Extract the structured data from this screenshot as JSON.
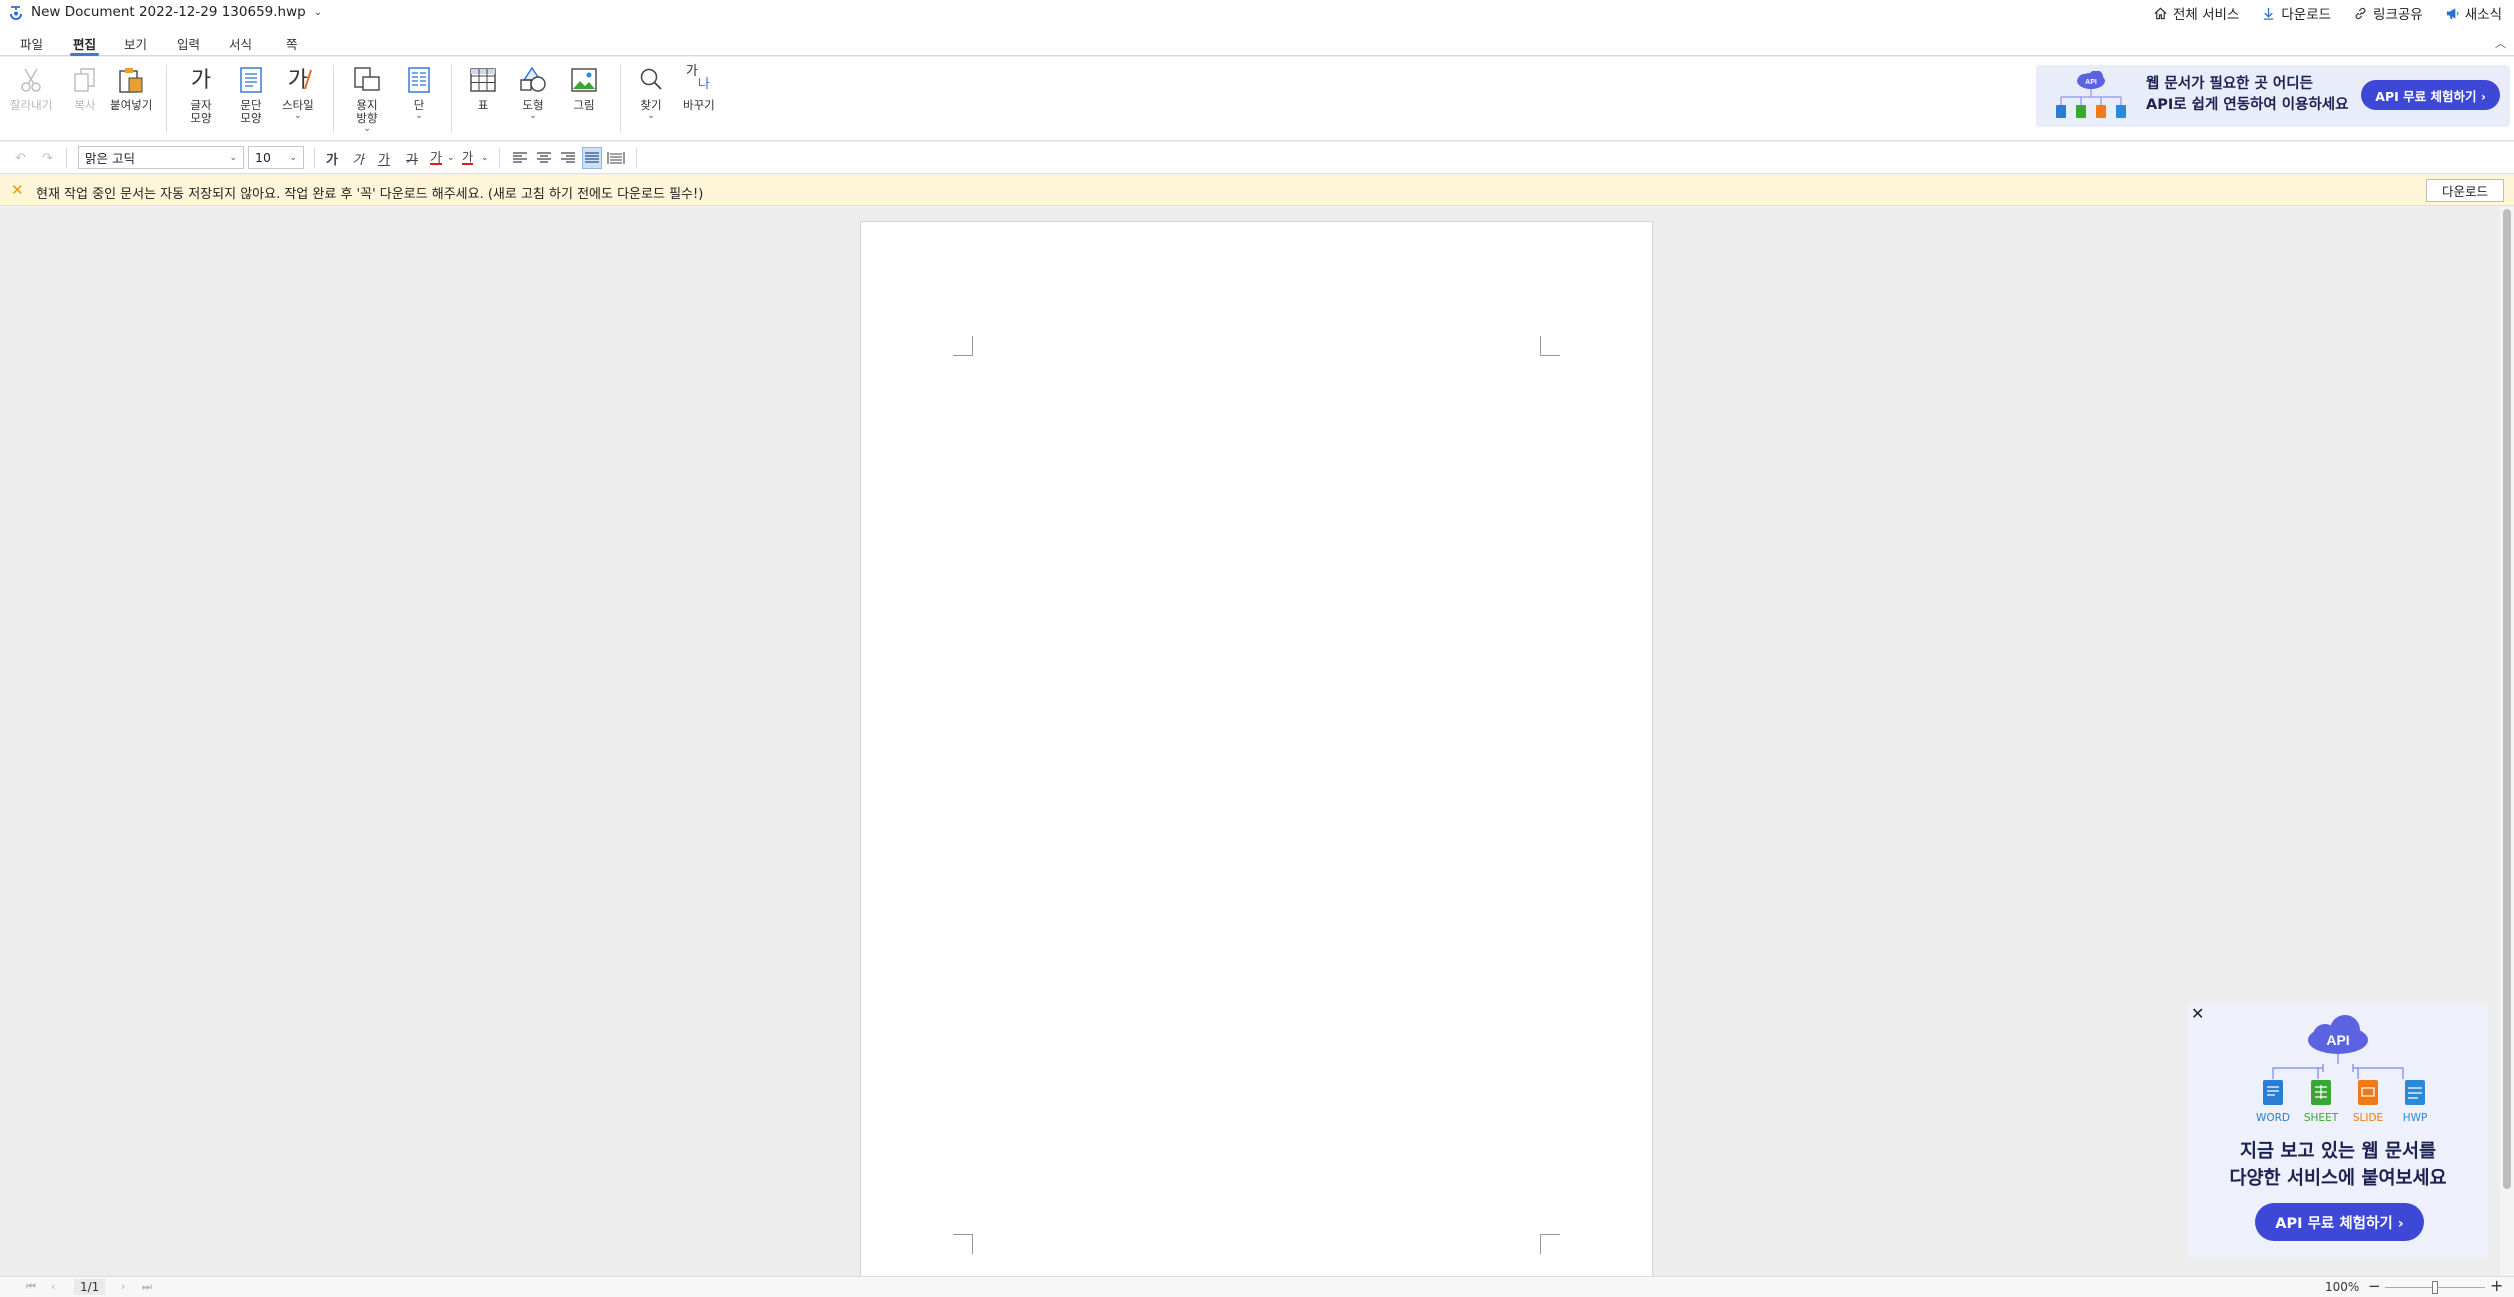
{
  "title_bar": {
    "doc_title": "New Document 2022-12-29 130659.hwp",
    "links": [
      {
        "label": "전체 서비스",
        "icon": "home-icon"
      },
      {
        "label": "다운로드",
        "icon": "download-icon"
      },
      {
        "label": "링크공유",
        "icon": "link-icon"
      },
      {
        "label": "새소식",
        "icon": "megaphone-icon"
      }
    ]
  },
  "menu": {
    "tabs": [
      "파일",
      "편집",
      "보기",
      "입력",
      "서식",
      "쪽"
    ],
    "active": "편집"
  },
  "ribbon": {
    "cut": "잘라내기",
    "copy": "복사",
    "paste": "붙여넣기",
    "char_shape": [
      "글자",
      "모양"
    ],
    "para_shape": [
      "문단",
      "모양"
    ],
    "style": "스타일",
    "paper_dir": [
      "용지",
      "방향"
    ],
    "column": "단",
    "table": "표",
    "shape": "도형",
    "picture": "그림",
    "find": "찾기",
    "replace": "바꾸기",
    "char_glyph": "가",
    "style_glyph": "가",
    "replace_glyph_a": "가",
    "replace_glyph_b": "나"
  },
  "ad_banner": {
    "line1": "웹 문서가 필요한 곳 어디든",
    "line2": "API로 쉽게 연동하여 이용하세요",
    "button": "API 무료 체험하기 ›",
    "cloud_label": "API"
  },
  "format_bar": {
    "font": "맑은 고딕",
    "size": "10",
    "bold_glyph": "가",
    "italic_glyph": "가",
    "underline_glyph": "가",
    "strike_glyph": "가",
    "font_color_glyph": "가",
    "highlight_glyph": "가"
  },
  "notice": {
    "message": "현재 작업 중인 문서는 자동 저장되지 않아요. 작업 완료 후 '꼭' 다운로드 해주세요. (새로 고침 하기 전에도 다운로드 필수!)",
    "download": "다운로드"
  },
  "popup": {
    "cloud_label": "API",
    "labels": [
      "WORD",
      "SHEET",
      "SLIDE",
      "HWP"
    ],
    "line1": "지금 보고 있는 웹 문서를",
    "line2": "다양한 서비스에 붙여보세요",
    "button": "API 무료 체험하기 ›"
  },
  "status": {
    "page": "1/1",
    "zoom": "100%"
  },
  "colors": {
    "accent": "#3a7bd5",
    "api_button": "#3d49d6",
    "notice_bg": "#fff5d9",
    "word": "#2b7cd3",
    "sheet": "#3aa635",
    "slide": "#f07b16",
    "hwp": "#2b8ad8"
  }
}
